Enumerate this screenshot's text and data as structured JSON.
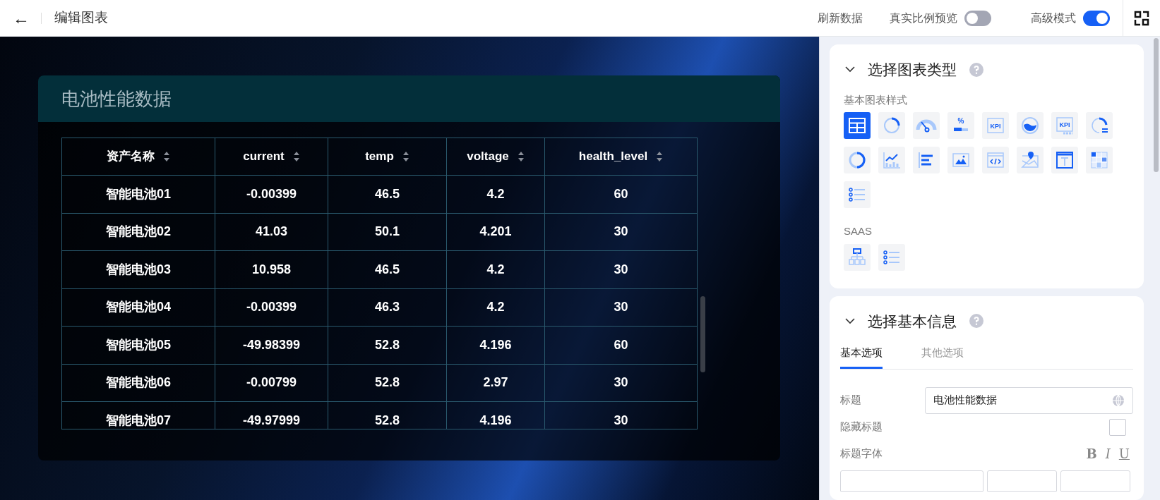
{
  "header": {
    "back": "←",
    "title": "编辑图表",
    "refresh": "刷新数据",
    "toggles": [
      {
        "label": "真实比例预览",
        "on": false
      },
      {
        "label": "高级模式",
        "on": true
      }
    ]
  },
  "widget": {
    "title": "电池性能数据",
    "columns": [
      "资产名称",
      "current",
      "temp",
      "voltage",
      "health_level"
    ],
    "rows": [
      [
        "智能电池01",
        "-0.00399",
        "46.5",
        "4.2",
        "60"
      ],
      [
        "智能电池02",
        "41.03",
        "50.1",
        "4.201",
        "30"
      ],
      [
        "智能电池03",
        "10.958",
        "46.5",
        "4.2",
        "30"
      ],
      [
        "智能电池04",
        "-0.00399",
        "46.3",
        "4.2",
        "30"
      ],
      [
        "智能电池05",
        "-49.98399",
        "52.8",
        "4.196",
        "60"
      ],
      [
        "智能电池06",
        "-0.00799",
        "52.8",
        "2.97",
        "30"
      ],
      [
        "智能电池07",
        "-49.97999",
        "52.8",
        "4.196",
        "30"
      ]
    ]
  },
  "chart_type_section": {
    "title": "选择图表类型",
    "groups": [
      {
        "label": "基本图表样式",
        "items": [
          {
            "kind": "table",
            "selected": true
          },
          {
            "kind": "ring",
            "selected": false
          },
          {
            "kind": "gauge",
            "selected": false
          },
          {
            "kind": "percent",
            "glyph": "%",
            "selected": false
          },
          {
            "kind": "kpi",
            "glyph": "KPI",
            "selected": false
          },
          {
            "kind": "liquid",
            "selected": false
          },
          {
            "kind": "kpi-card",
            "glyph": "KPI",
            "selected": false
          },
          {
            "kind": "ring-list",
            "selected": false
          },
          {
            "kind": "donut",
            "selected": false
          },
          {
            "kind": "line-bar",
            "selected": false
          },
          {
            "kind": "bar",
            "selected": false
          },
          {
            "kind": "image",
            "selected": false
          },
          {
            "kind": "code",
            "selected": false
          },
          {
            "kind": "map",
            "selected": false
          },
          {
            "kind": "text",
            "selected": false
          },
          {
            "kind": "heatmap",
            "selected": false
          },
          {
            "kind": "list",
            "selected": false
          }
        ]
      },
      {
        "label": "SAAS",
        "items": [
          {
            "kind": "org",
            "selected": false
          },
          {
            "kind": "list",
            "selected": false
          }
        ]
      }
    ]
  },
  "basic_info_section": {
    "title": "选择基本信息",
    "tabs": [
      {
        "label": "基本选项",
        "selected": true
      },
      {
        "label": "其他选项",
        "selected": false
      }
    ],
    "title_field": {
      "label": "标题",
      "value": "电池性能数据"
    },
    "hide_title": {
      "label": "隐藏标题",
      "checked": false
    },
    "title_font": {
      "label": "标题字体",
      "styles": [
        "B",
        "I",
        "U"
      ]
    }
  }
}
